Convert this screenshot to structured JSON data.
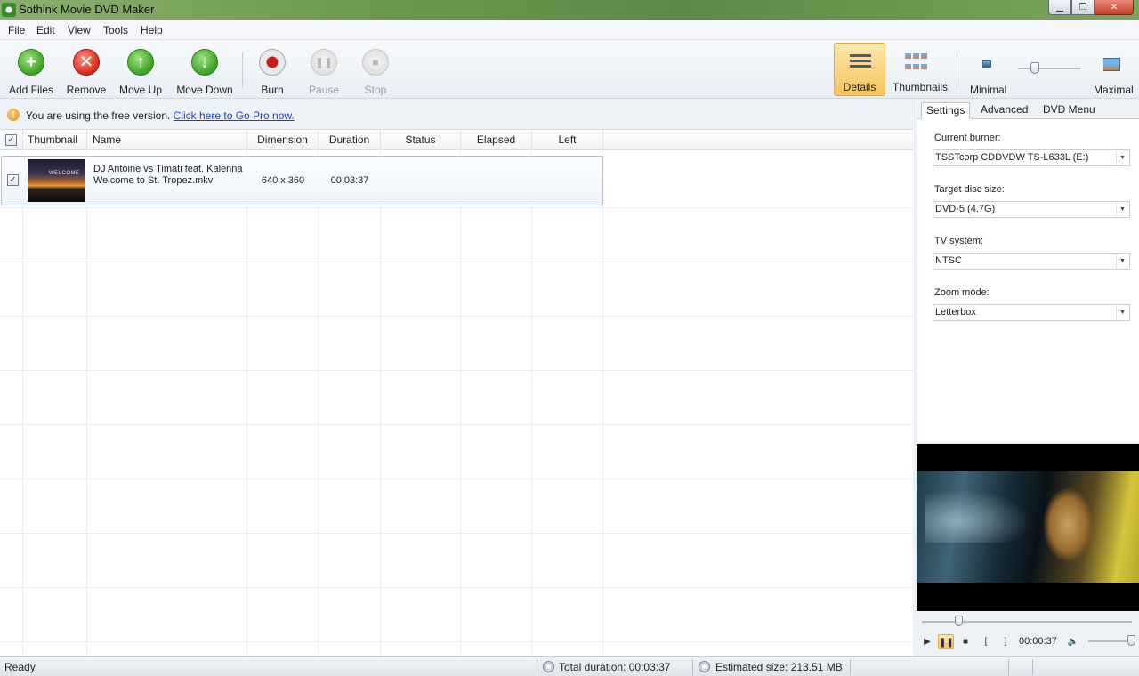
{
  "window": {
    "title": "Sothink Movie DVD Maker",
    "min": "▁",
    "max": "❐",
    "close": "✕"
  },
  "menu": [
    "File",
    "Edit",
    "View",
    "Tools",
    "Help"
  ],
  "toolbar": {
    "add_files": "Add Files",
    "remove": "Remove",
    "move_up": "Move Up",
    "move_down": "Move Down",
    "burn": "Burn",
    "pause": "Pause",
    "stop": "Stop",
    "details": "Details",
    "thumbnails": "Thumbnails",
    "minimal": "Minimal",
    "maximal": "Maximal"
  },
  "notice": {
    "text": "You are using the free version.",
    "link": "Click here to Go Pro now."
  },
  "list": {
    "headers": {
      "thumbnail": "Thumbnail",
      "name": "Name",
      "dimension": "Dimension",
      "duration": "Duration",
      "status": "Status",
      "elapsed": "Elapsed",
      "left": "Left"
    },
    "rows": [
      {
        "thumb_text": "WELCOME",
        "name": "DJ Antoine vs Timati feat. Kalenna  Welcome to St. Tropez.mkv",
        "dimension": "640 x 360",
        "duration": "00:03:37",
        "status": "",
        "elapsed": "",
        "left": ""
      }
    ]
  },
  "panel": {
    "tabs": [
      "Settings",
      "Advanced",
      "DVD Menu"
    ],
    "current_burner_label": "Current burner:",
    "current_burner": "TSSTcorp CDDVDW TS-L633L (E:)",
    "disc_size_label": "Target disc size:",
    "disc_size": "DVD-5 (4.7G)",
    "tv_system_label": "TV system:",
    "tv_system": "NTSC",
    "zoom_mode_label": "Zoom mode:",
    "zoom_mode": "Letterbox"
  },
  "player": {
    "time": "00:00:37"
  },
  "status": {
    "ready": "Ready",
    "total_duration": "Total duration: 00:03:37",
    "estimated_size": "Estimated size: 213.51 MB"
  }
}
